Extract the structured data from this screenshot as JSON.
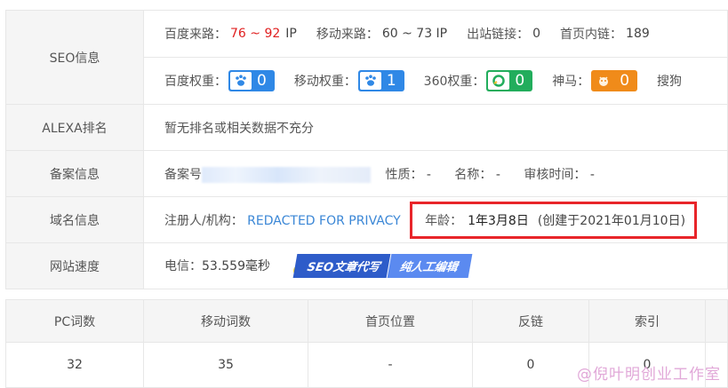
{
  "seo": {
    "label": "SEO信息",
    "baidu_source_label": "百度来路：",
    "baidu_source_range": "76 ~ 92",
    "baidu_source_unit": "IP",
    "mobile_source_label": "移动来路：",
    "mobile_source_value": "60 ~ 73 IP",
    "outbound_label": "出站链接：",
    "outbound_value": "0",
    "internal_label": "首页内链：",
    "internal_value": "189",
    "baidu_weight_label": "百度权重：",
    "baidu_weight_value": "0",
    "mobile_weight_label": "移动权重：",
    "mobile_weight_value": "1",
    "weight360_label": "360权重：",
    "weight360_value": "0",
    "shenma_label": "神马：",
    "shenma_value": "0",
    "sogou_label": "搜狗"
  },
  "alexa": {
    "label": "ALEXA排名",
    "value": "暂无排名或相关数据不充分"
  },
  "icp": {
    "label": "备案信息",
    "number_label": "备案号",
    "nature_label": "性质：",
    "nature_value": "-",
    "name_label": "名称：",
    "name_value": "-",
    "review_label": "审核时间：",
    "review_value": "-"
  },
  "domain": {
    "label": "域名信息",
    "registrant_label": "注册人/机构：",
    "registrant_value": "REDACTED FOR PRIVACY",
    "age_label": "年龄：",
    "age_value": "1年3月8日",
    "created_note": "(创建于2021年01月10日)"
  },
  "speed": {
    "label": "网站速度",
    "telecom_label": "电信：",
    "telecom_value": "53.559毫秒",
    "promo_text_1": "SEO文章代写",
    "promo_text_2": "纯人工编辑"
  },
  "words_table": {
    "headers": [
      "PC词数",
      "移动词数",
      "首页位置",
      "反链",
      "索引"
    ],
    "row": [
      "32",
      "35",
      "-",
      "0",
      "0"
    ]
  },
  "watermark": "@倪叶明创业工作室",
  "colors": {
    "accent_red": "#e02020",
    "badge_blue": "#2f88e6",
    "badge_green": "#22ad5c",
    "badge_orange": "#f08b1a",
    "link_blue": "#3b87d6",
    "highlight_border": "#e8252a"
  }
}
